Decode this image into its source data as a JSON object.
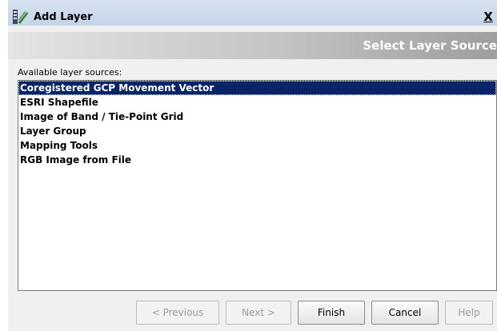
{
  "window": {
    "title": "Add Layer",
    "close_label": "X",
    "icon": "snap-app-icon"
  },
  "header": {
    "title": "Select Layer Source"
  },
  "list": {
    "label": "Available layer sources:",
    "items": [
      "Coregistered GCP Movement Vector",
      "ESRI Shapefile",
      "Image of Band / Tie-Point Grid",
      "Layer Group",
      "Mapping Tools",
      "RGB Image from File"
    ],
    "selected_index": 0
  },
  "buttons": {
    "previous": "< Previous",
    "next": "Next >",
    "finish": "Finish",
    "cancel": "Cancel",
    "help": "Help"
  },
  "colors": {
    "selection": "#0a246a",
    "titlebar": "#c4d4e8",
    "disabled_text": "#9a9a9a"
  }
}
